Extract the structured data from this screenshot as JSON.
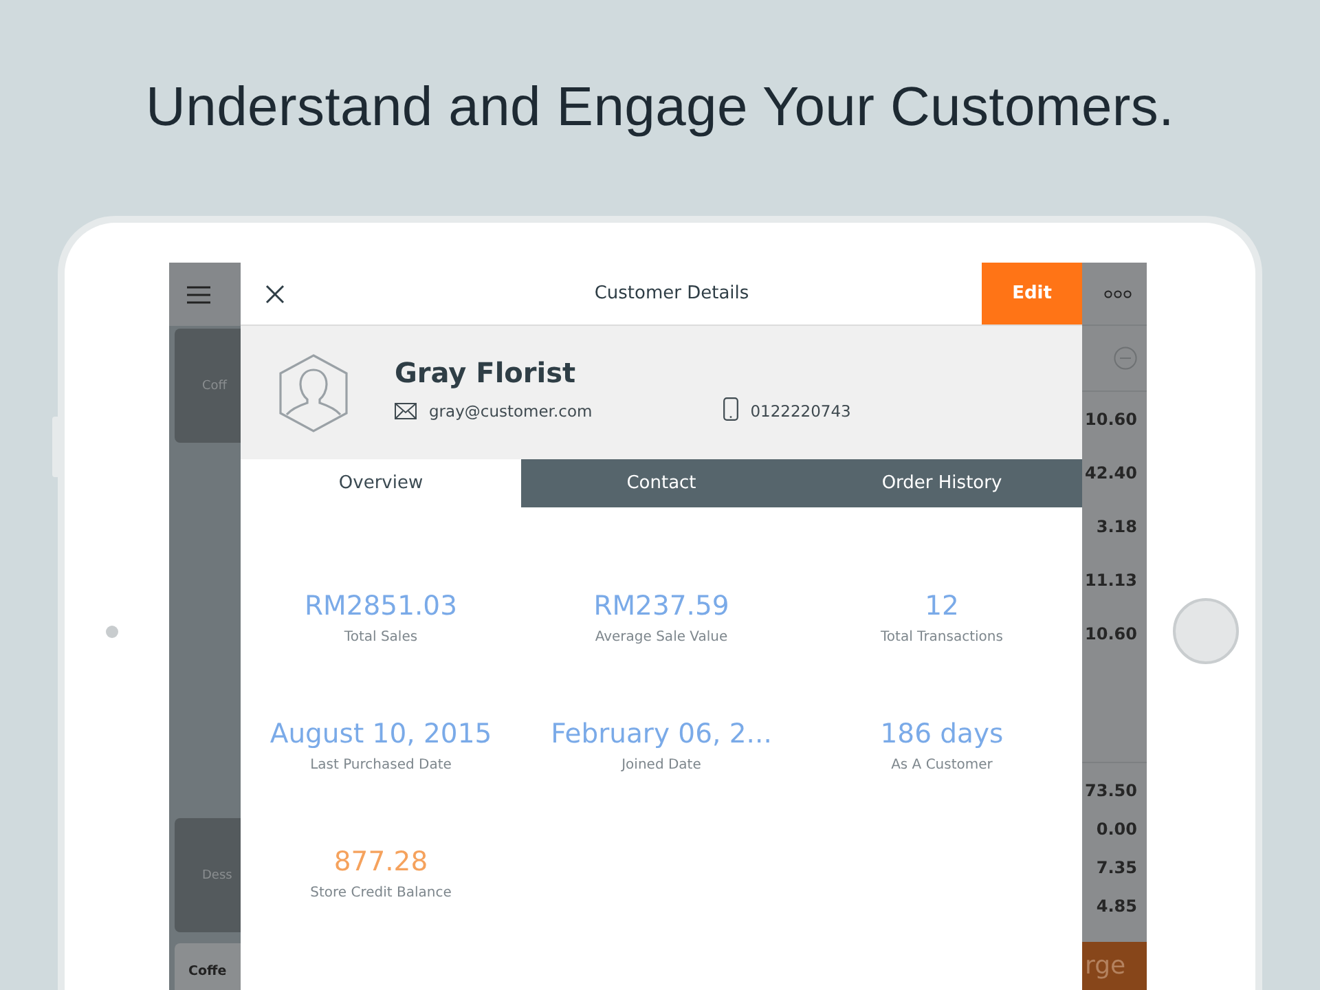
{
  "headline": "Understand and Engage Your Customers.",
  "background_app": {
    "left_cards": [
      {
        "label": "Coff",
        "kind": "category"
      },
      {
        "label": "Dess",
        "kind": "category"
      },
      {
        "label": "Coffe",
        "kind": "product"
      }
    ],
    "line_amounts": [
      "10.60",
      "42.40",
      "3.18",
      "11.13",
      "10.60"
    ],
    "summary_amounts": [
      "73.50",
      "0.00",
      "7.35",
      "4.85"
    ],
    "charge_button": "rge"
  },
  "modal": {
    "title": "Customer Details",
    "edit_button": "Edit",
    "customer": {
      "name": "Gray Florist",
      "email": "gray@customer.com",
      "phone": "0122220743"
    },
    "tabs": [
      {
        "label": "Overview",
        "selected": true
      },
      {
        "label": "Contact",
        "selected": false
      },
      {
        "label": "Order History",
        "selected": false
      }
    ],
    "stats": [
      {
        "value": "RM2851.03",
        "label": "Total Sales",
        "color": "#7aaae8"
      },
      {
        "value": "RM237.59",
        "label": "Average Sale Value",
        "color": "#7aaae8"
      },
      {
        "value": "12",
        "label": "Total Transactions",
        "color": "#7aaae8"
      },
      {
        "value": "August 10, 2015",
        "label": "Last Purchased Date",
        "color": "#7aaae8"
      },
      {
        "value": "February 06, 2...",
        "label": "Joined Date",
        "color": "#7aaae8"
      },
      {
        "value": "186 days",
        "label": "As A Customer",
        "color": "#7aaae8"
      },
      {
        "value": "877.28",
        "label": "Store Credit Balance",
        "color": "#f5a25d"
      }
    ]
  }
}
